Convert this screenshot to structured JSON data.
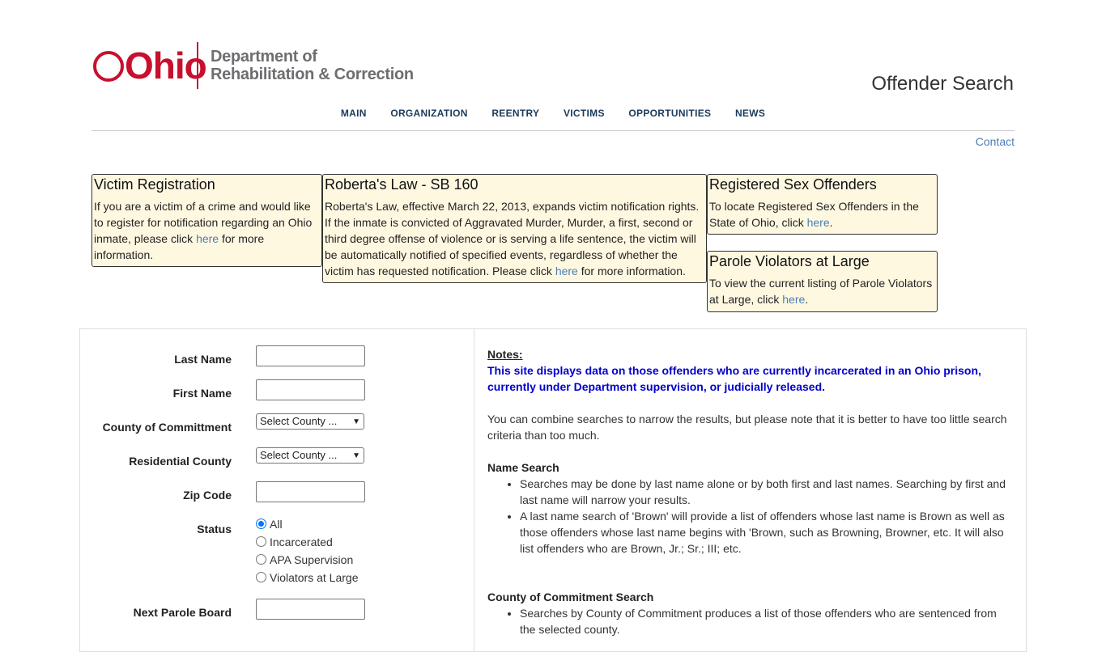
{
  "header": {
    "logo_word": "Ohio",
    "logo_dept_line1": "Department of",
    "logo_dept_line2": "Rehabilitation & Correction",
    "page_title": "Offender Search",
    "nav": [
      "MAIN",
      "ORGANIZATION",
      "REENTRY",
      "VICTIMS",
      "OPPORTUNITIES",
      "NEWS"
    ],
    "contact": "Contact"
  },
  "boxes": {
    "victim": {
      "title": "Victim Registration",
      "text_before": "If you are a victim of a crime and would like to register for notification regarding an Ohio inmate, please click ",
      "link": "here",
      "text_after": " for more information."
    },
    "roberta": {
      "title": "Roberta's Law - SB 160",
      "text_before": "Roberta's Law, effective March 22, 2013, expands victim notification rights. If the inmate is convicted of Aggravated Murder, Murder, a first, second or third degree offense of violence or is serving a life sentence, the victim will be automatically notified of specified events, regardless of whether the victim has requested notification. Please click ",
      "link": "here",
      "text_after": " for more information."
    },
    "rso": {
      "title": "Registered Sex Offenders",
      "text_before": "To locate Registered Sex Offenders in the State of Ohio, click ",
      "link": "here",
      "text_after": "."
    },
    "parole": {
      "title": "Parole Violators at Large",
      "text_before": "To view the current listing of Parole Violators at Large, click ",
      "link": "here",
      "text_after": "."
    }
  },
  "form": {
    "last_name_label": "Last Name",
    "last_name_value": "",
    "first_name_label": "First Name",
    "first_name_value": "",
    "county_commitment_label": "County of Committment",
    "county_commitment_selected": "Select County ...",
    "residential_county_label": "Residential County",
    "residential_county_selected": "Select County ...",
    "zip_label": "Zip Code",
    "zip_value": "",
    "status_label": "Status",
    "status_options": [
      "All",
      "Incarcerated",
      "APA Supervision",
      "Violators at Large"
    ],
    "status_selected": "All",
    "next_parole_label": "Next Parole Board",
    "next_parole_value": ""
  },
  "notes": {
    "heading": "Notes:",
    "highlight": "This site displays data on those offenders who are currently incarcerated in an Ohio prison, currently under Department supervision, or judicially released.",
    "intro": "You can combine searches to narrow the results, but please note that it is better to have too little search criteria than too much.",
    "name_search_heading": "Name Search",
    "name_search_items": [
      "Searches may be done by last name alone or by both first and last names. Searching by first and last name will narrow your results.",
      "A last name search of 'Brown' will provide a list of offenders whose last name is Brown as well as those offenders whose last name begins with 'Brown, such as Browning, Browner, etc. It will also list offenders who are Brown, Jr.; Sr.; III; etc."
    ],
    "county_search_heading": "County of Commitment Search",
    "county_search_items": [
      "Searches by County of Commitment produces a list of those offenders who are sentenced from the selected county."
    ]
  }
}
